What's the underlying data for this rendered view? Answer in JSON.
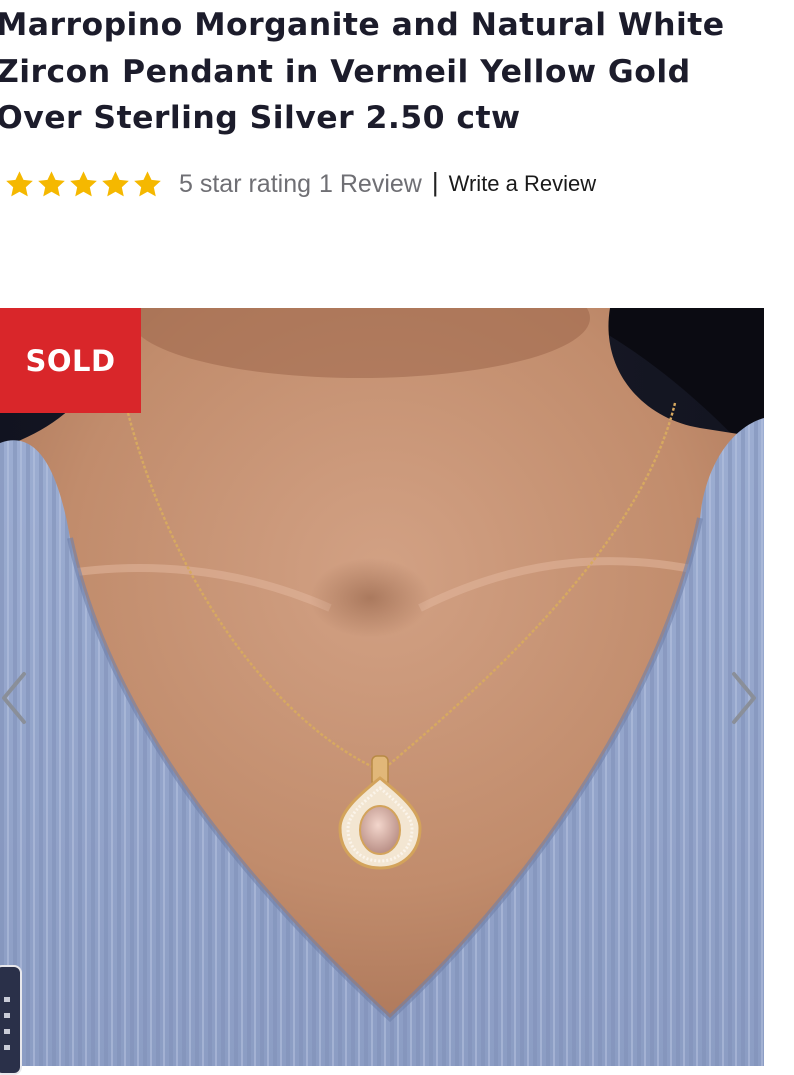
{
  "product": {
    "title": "Marropino Morganite and Natural White Zircon Pendant in Vermeil Yellow Gold Over Sterling Silver 2.50 ctw"
  },
  "rating": {
    "stars": 5,
    "star_color": "#F5B800",
    "rating_text": "5 star rating",
    "review_count": "1 Review",
    "separator": "|",
    "write_review_label": "Write a Review"
  },
  "gallery": {
    "badge": "SOLD",
    "badge_color": "#D9262A",
    "prev_icon": "chevron-left-icon",
    "next_icon": "chevron-right-icon"
  }
}
